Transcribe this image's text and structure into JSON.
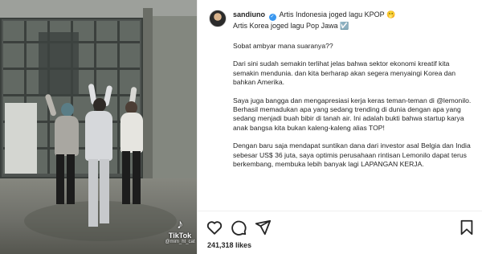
{
  "media": {
    "watermark_brand": "TikTok",
    "watermark_handle": "@mim_ht_cat"
  },
  "post": {
    "username": "sandiuno",
    "caption_line1": "Artis Indonesia joged lagu KPOP 🫢",
    "caption_line2": "Artis Korea joged lagu Pop Jawa ☑️",
    "paragraphs": [
      "Sobat ambyar mana suaranya??",
      "Dari sini sudah semakin terlihat jelas bahwa sektor ekonomi kreatif kita semakin mendunia. dan kita berharap akan segera menyaingi Korea dan bahkan Amerika.",
      "Saya juga bangga dan mengapresiasi kerja keras teman-teman di @lemonilo. Berhasil memadukan apa yang sedang trending di dunia dengan apa yang sedang menjadi buah bibir di tanah air. Ini adalah bukti bahwa startup karya anak bangsa kita bukan kaleng-kaleng alias TOP!",
      "Dengan baru saja mendapat suntikan dana dari investor asal Belgia dan India sebesar US$ 36 juta, saya optimis perusahaan rintisan Lemonilo dapat terus berkembang, membuka lebih banyak lagi LAPANGAN KERJA."
    ],
    "likes": "241,318 likes"
  },
  "icons": {
    "like": "heart-icon",
    "comment": "comment-icon",
    "share": "share-icon",
    "save": "bookmark-icon",
    "verified": "verified-badge-icon"
  },
  "colors": {
    "verified": "#3897f0",
    "text": "#262626",
    "divider": "#efefef"
  }
}
